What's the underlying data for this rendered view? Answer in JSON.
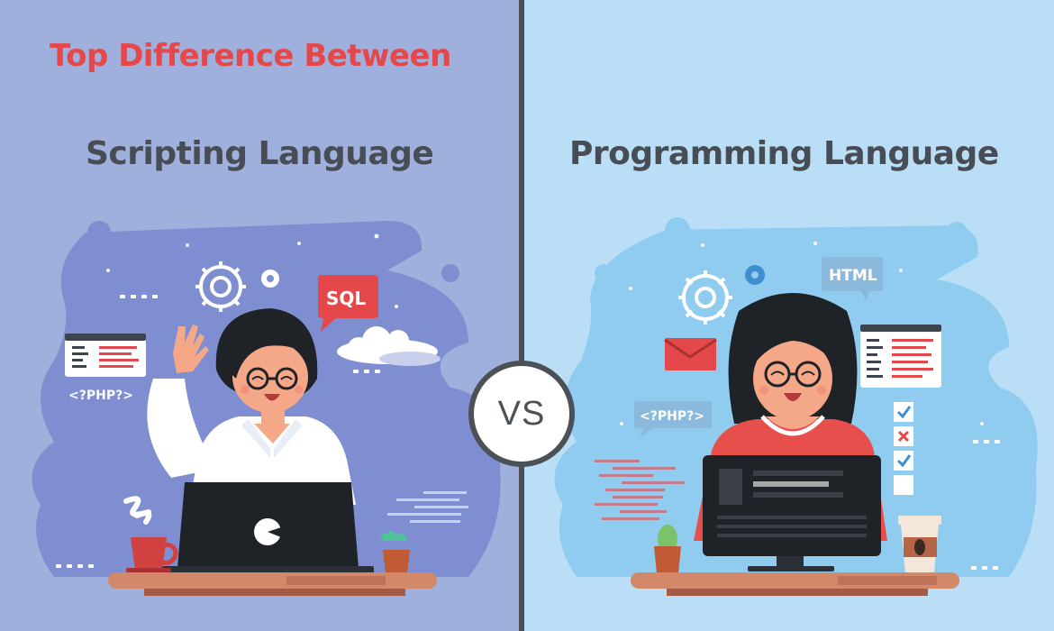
{
  "title": "Top Difference Between",
  "left": {
    "heading": "Scripting Language",
    "tags": {
      "sql": "SQL",
      "php": "<?PHP?>"
    }
  },
  "right": {
    "heading": "Programming Language",
    "tags": {
      "html": "HTML",
      "php": "<?PHP?>"
    }
  },
  "vs": "VS",
  "colors": {
    "left_bg": "#9fb0dc",
    "right_bg": "#b9def5",
    "title_red": "#e5484b",
    "heading_gray": "#484d55",
    "divider": "#4b5157"
  }
}
